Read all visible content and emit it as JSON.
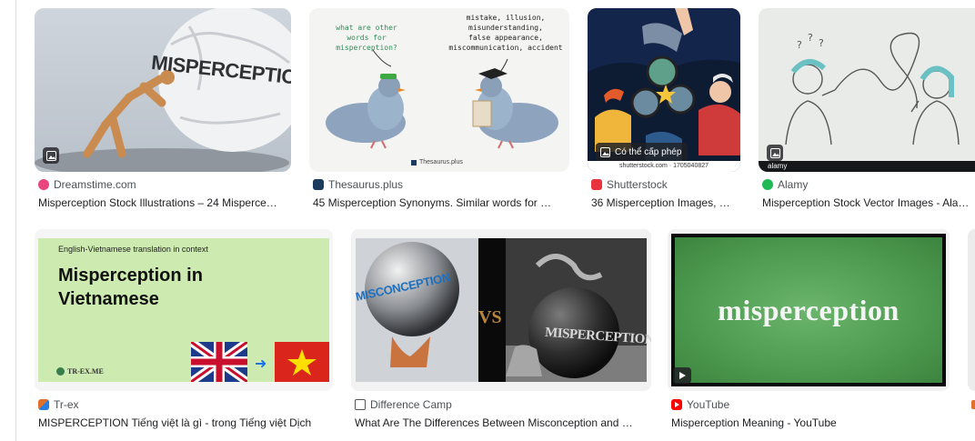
{
  "results": [
    {
      "source": "Dreamstime.com",
      "title": "Misperception Stock Illustrations – 24 Misperce…",
      "favicon_color": "#e8467c",
      "image_text": "MISPERCEPTION"
    },
    {
      "source": "Thesaurus.plus",
      "title": "45 Misperception Synonyms. Similar words for …",
      "favicon_color": "#1a3b5d",
      "bubble_left": "what are other\nwords for\nmisperception?",
      "bubble_right": "mistake, illusion,\nmisunderstanding,\nfalse appearance,\nmiscommunication, accident",
      "watermark": "Thesaurus.plus"
    },
    {
      "source": "Shutterstock",
      "title": "36 Misperception Images, …",
      "favicon_color": "#e8323c",
      "license_badge": "Có thể cấp phép",
      "watermark": "shutterstock.com · 1705040827"
    },
    {
      "source": "Alamy",
      "title": "Misperception Stock Vector Images - Ala…",
      "favicon_color": "#1db954",
      "watermark": "alamy"
    },
    {
      "source": "Tr-ex",
      "title": "MISPERCEPTION Tiếng việt là gì - trong Tiếng việt Dịch",
      "favicon_color": "#e0702a",
      "overline": "English-Vietnamese translation in context",
      "heading_line1": "Misperception in",
      "heading_line2": "Vietnamese",
      "logo": "TR-EX.ME"
    },
    {
      "source": "Difference Camp",
      "title": "What Are The Differences Between Misconception and …",
      "favicon_color": "#555555",
      "left_text": "MISCONCEPTION",
      "vs_text": "VS",
      "right_text": "MISPERCEPTION"
    },
    {
      "source": "YouTube",
      "title": "Misperception Meaning - YouTube",
      "favicon_color": "#ff0000",
      "image_text": "misperception"
    }
  ]
}
